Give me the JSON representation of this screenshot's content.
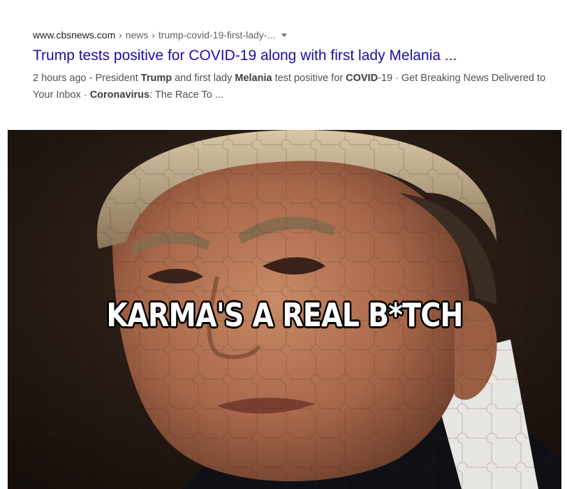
{
  "search_result": {
    "url": {
      "domain": "www.cbsnews.com",
      "separator": "›",
      "path_1": "news",
      "path_2": "trump-covid-19-first-lady-..."
    },
    "title": "Trump tests positive for COVID-19 along with first lady Melania ...",
    "snippet": {
      "date": "2 hours ago",
      "dash": " - ",
      "t1": "President ",
      "b1": "Trump",
      "t2": " and first lady ",
      "b2": "Melania",
      "t3": " test positive for ",
      "b3": "COVID",
      "t4": "-19 · Get Breaking News Delivered to Your Inbox · ",
      "b4": "Coronavirus",
      "t5": ": The Race To ..."
    }
  },
  "meme": {
    "caption": "KARMA'S A REAL B*TCH"
  },
  "colors": {
    "title_link": "#1a0dab",
    "snippet_text": "#4d5156",
    "url_text": "#202124",
    "caption_fill": "#ffffff",
    "caption_outline": "#000000"
  },
  "icons": {
    "url_menu": "caret-down-icon"
  }
}
